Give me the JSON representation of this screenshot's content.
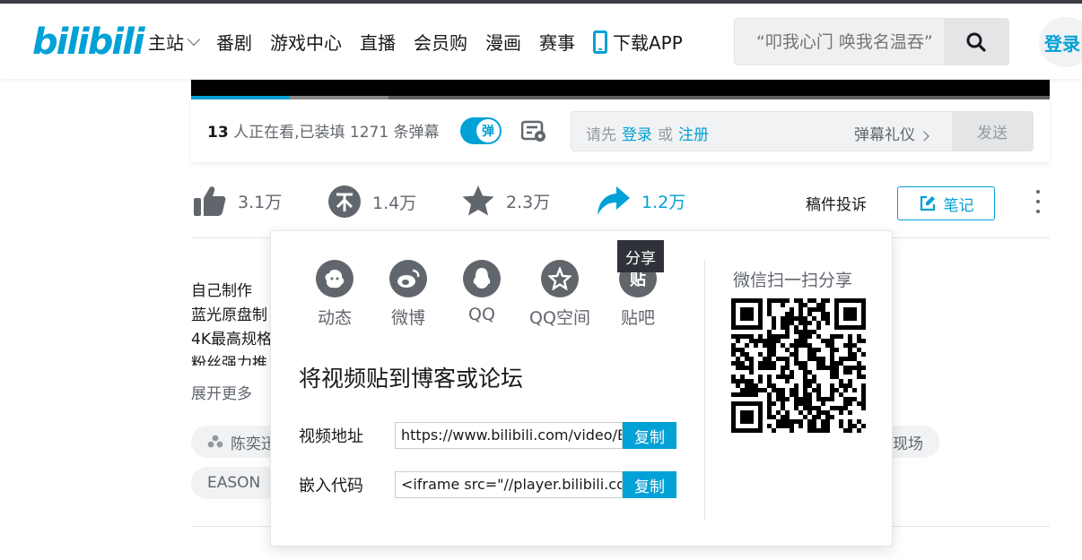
{
  "header": {
    "logo": "bilibili",
    "nav": [
      {
        "label": "主站",
        "has_dropdown": true
      },
      {
        "label": "番剧"
      },
      {
        "label": "游戏中心"
      },
      {
        "label": "直播"
      },
      {
        "label": "会员购"
      },
      {
        "label": "漫画"
      },
      {
        "label": "赛事"
      },
      {
        "label": "下载APP",
        "icon": "phone-icon"
      }
    ],
    "search_placeholder": "“叩我心门 唤我名温吞”",
    "login": "登录"
  },
  "danmaku_bar": {
    "viewer_count": "13",
    "viewer_text": " 人正在看,已装填 1271 条弹幕",
    "toggle_label": "弹",
    "hint_prefix": "请先",
    "hint_login": "登录",
    "hint_or": "或",
    "hint_register": "注册",
    "etiquette": "弹幕礼仪",
    "send": "发送"
  },
  "toolbar": {
    "like": "3.1万",
    "coin": "1.4万",
    "favorite": "2.3万",
    "share": "1.2万",
    "complain": "稿件投诉",
    "note": "笔记"
  },
  "description": {
    "lines": [
      "自己制作",
      "蓝光原盘制",
      "4K最高规格",
      "粉丝强力推"
    ],
    "expand": "展开更多"
  },
  "tags": [
    "陈奕迅",
    "现场",
    "EASON"
  ],
  "share_popup": {
    "tooltip": "分享",
    "targets": [
      {
        "label": "动态",
        "icon": "dynamic-icon"
      },
      {
        "label": "微博",
        "icon": "weibo-icon"
      },
      {
        "label": "QQ",
        "icon": "qq-icon"
      },
      {
        "label": "QQ空间",
        "icon": "qzone-icon"
      },
      {
        "label": "贴吧",
        "icon": "tieba-icon",
        "glyph": "贴"
      }
    ],
    "post_title": "将视频贴到博客或论坛",
    "video_url_label": "视频地址",
    "video_url_value": "https://www.bilibili.com/video/BV",
    "embed_label": "嵌入代码",
    "embed_value": "<iframe src=\"//player.bilibili.com/player.html",
    "copy": "复制",
    "wechat_title": "微信扫一扫分享"
  }
}
